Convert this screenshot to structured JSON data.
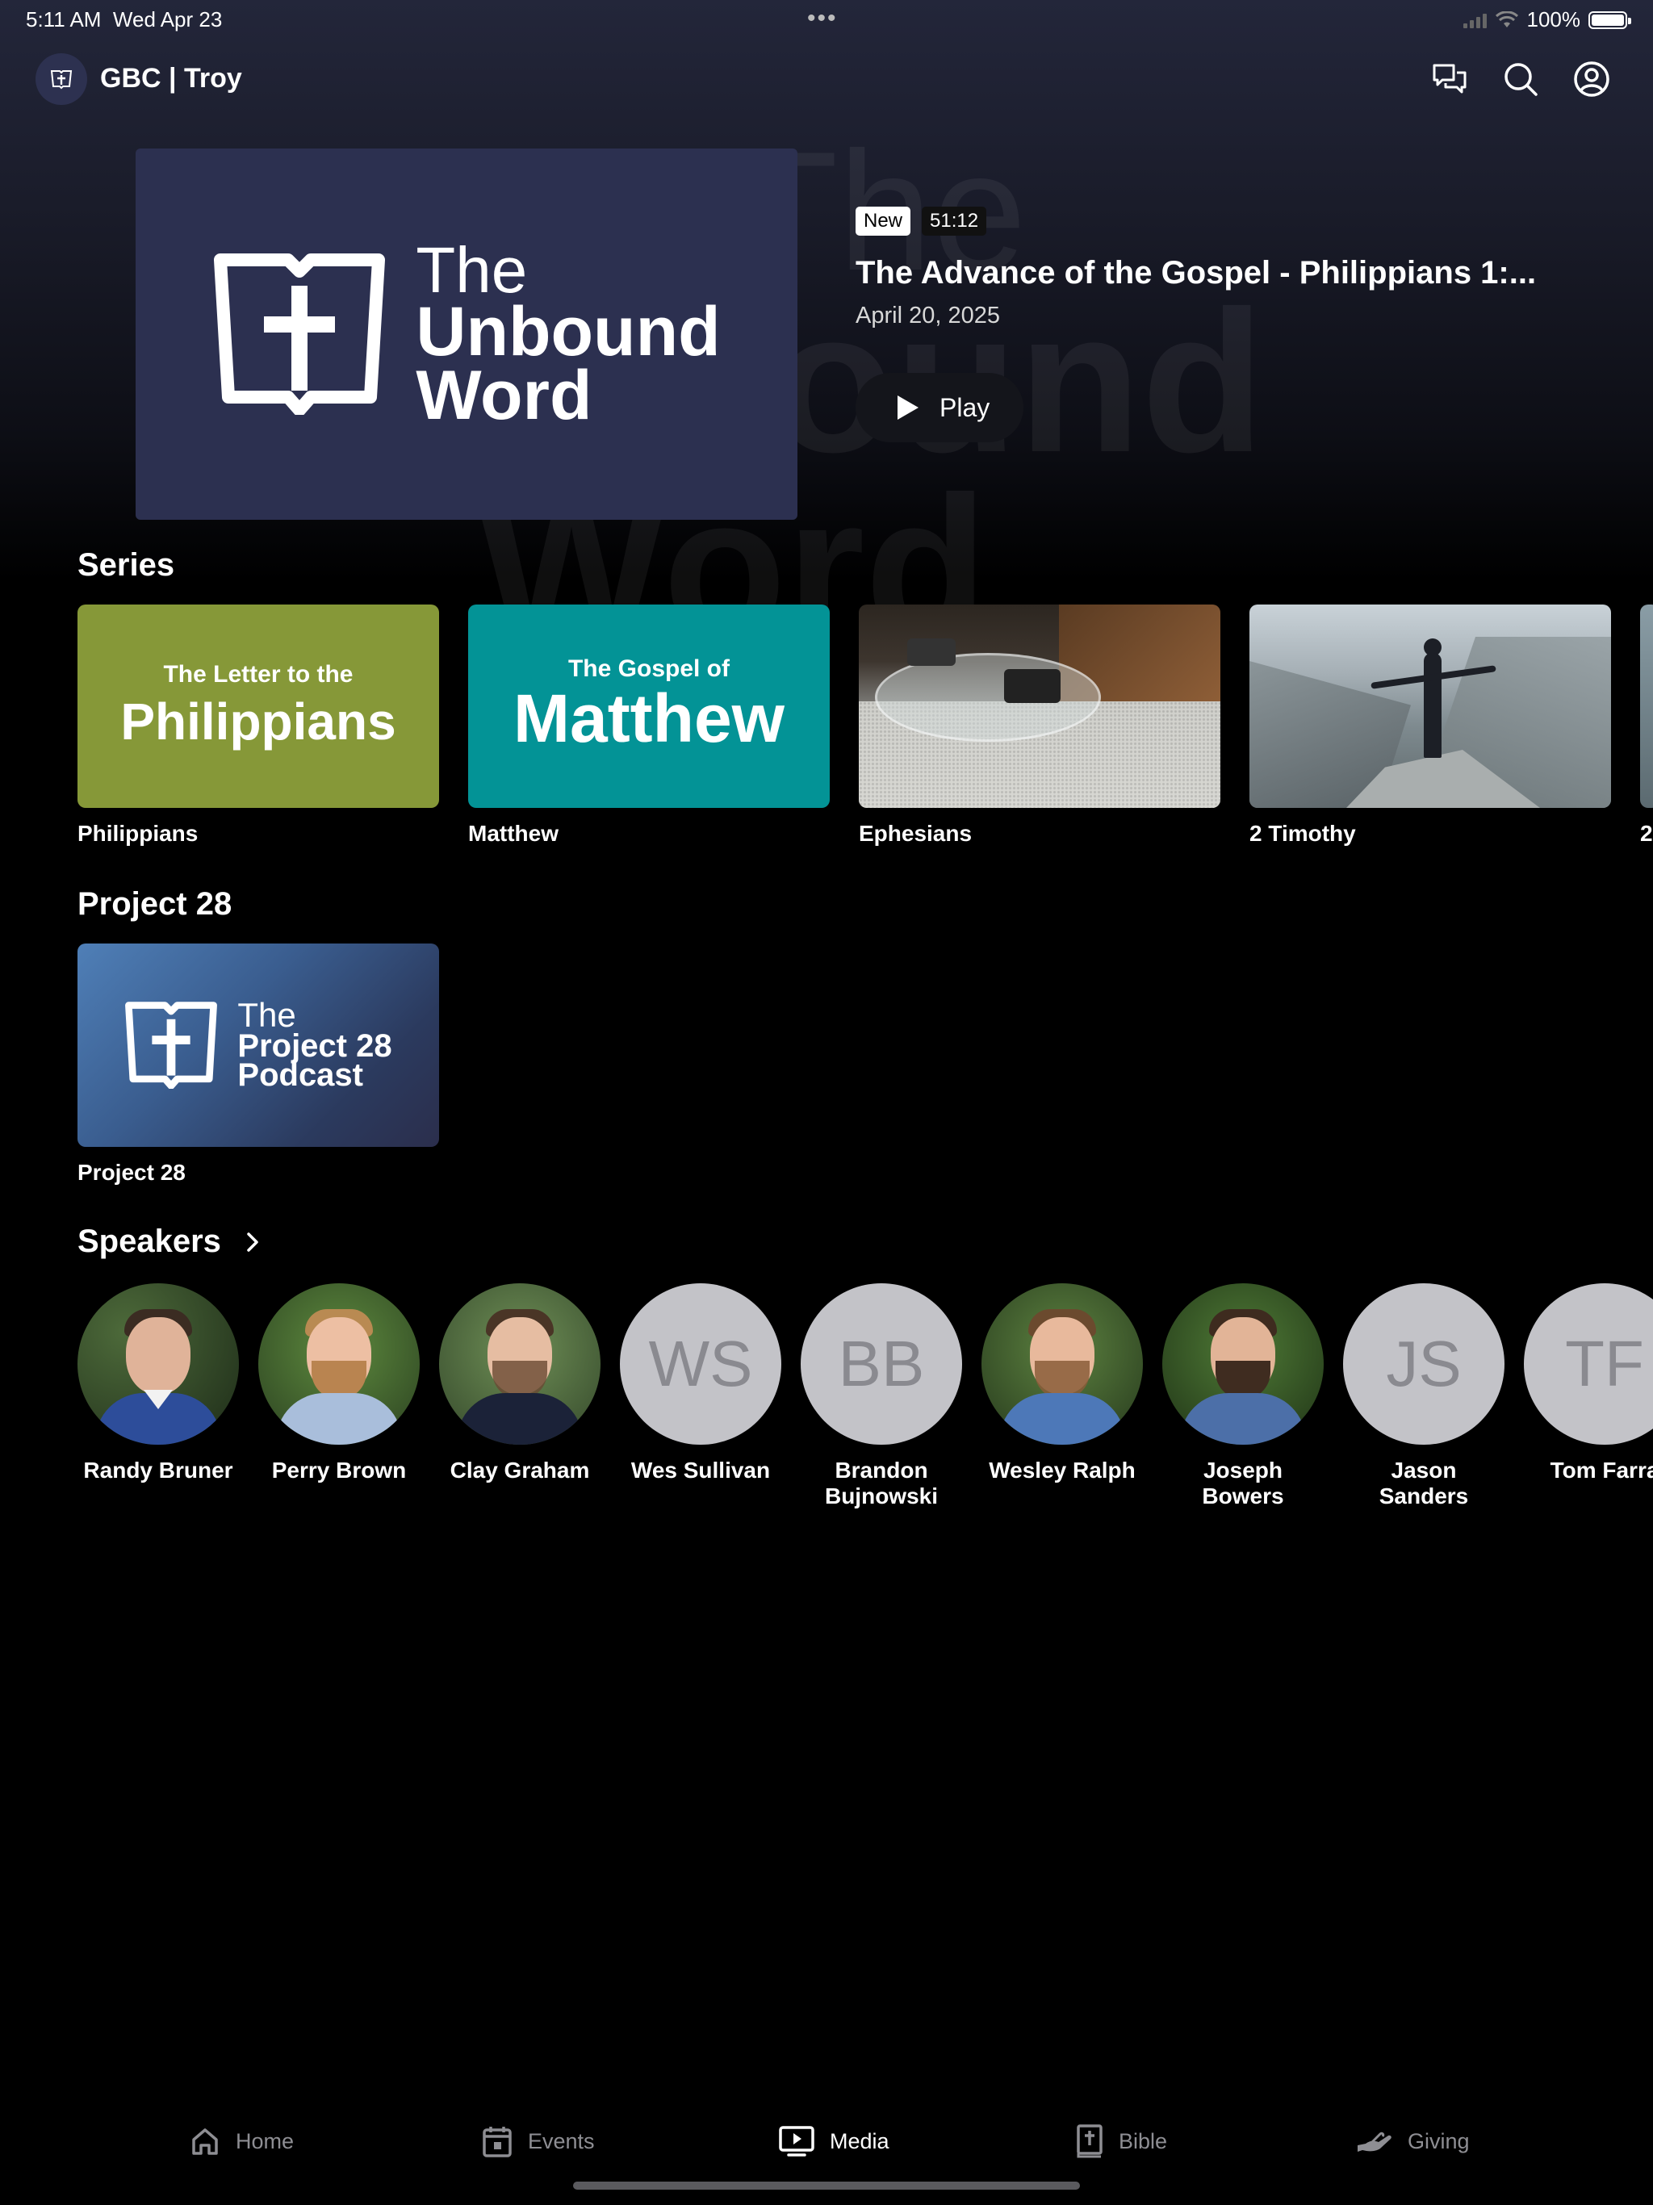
{
  "status_bar": {
    "time": "5:11 AM",
    "date": "Wed Apr 23",
    "battery": "100%"
  },
  "header": {
    "app_title": "GBC | Troy",
    "icons": [
      "chat-icon",
      "search-icon",
      "account-icon"
    ]
  },
  "hero": {
    "artwork_text": {
      "line1": "The",
      "line2": "Unbound",
      "line3": "Word"
    },
    "badge_new": "New",
    "duration": "51:12",
    "title": "The Advance of the Gospel - Philippians 1:...",
    "date": "April 20, 2025",
    "play_label": "Play",
    "background_text": {
      "line1": "The",
      "line2": "Unbound",
      "line3": "Word"
    }
  },
  "series": {
    "title": "Series",
    "items": [
      {
        "label": "Philippians",
        "art_small": "The Letter to the",
        "art_big": "Philippians",
        "color": "#869838"
      },
      {
        "label": "Matthew",
        "art_small": "The Gospel of",
        "art_big": "Matthew",
        "color": "#039396"
      },
      {
        "label": "Ephesians"
      },
      {
        "label": "2 Timothy"
      },
      {
        "label": "2"
      }
    ]
  },
  "project28": {
    "title": "Project 28",
    "items": [
      {
        "label": "Project 28",
        "art_line1": "The",
        "art_line2": "Project 28",
        "art_line3": "Podcast"
      }
    ]
  },
  "speakers": {
    "title": "Speakers",
    "items": [
      {
        "name": "Randy Bruner",
        "type": "photo"
      },
      {
        "name": "Perry Brown",
        "type": "photo"
      },
      {
        "name": "Clay Graham",
        "type": "photo"
      },
      {
        "name": "Wes Sullivan",
        "initials": "WS",
        "type": "initials"
      },
      {
        "name_line1": "Brandon",
        "name_line2": "Bujnowski",
        "initials": "BB",
        "type": "initials"
      },
      {
        "name": "Wesley Ralph",
        "type": "photo"
      },
      {
        "name_line1": "Joseph",
        "name_line2": "Bowers",
        "type": "photo"
      },
      {
        "name_line1": "Jason",
        "name_line2": "Sanders",
        "initials": "JS",
        "type": "initials"
      },
      {
        "name": "Tom Farra",
        "initials": "TF",
        "type": "initials"
      }
    ]
  },
  "tabbar": {
    "tabs": [
      {
        "label": "Home",
        "icon": "home-icon"
      },
      {
        "label": "Events",
        "icon": "calendar-icon"
      },
      {
        "label": "Media",
        "icon": "tv-play-icon",
        "active": true
      },
      {
        "label": "Bible",
        "icon": "bible-icon"
      },
      {
        "label": "Giving",
        "icon": "giving-hand-icon"
      }
    ]
  },
  "colors": {
    "background": "#000000",
    "hero_art": "#2c3050",
    "philippians": "#869838",
    "matthew": "#039396",
    "initials_avatar": "#c3c3c8"
  }
}
